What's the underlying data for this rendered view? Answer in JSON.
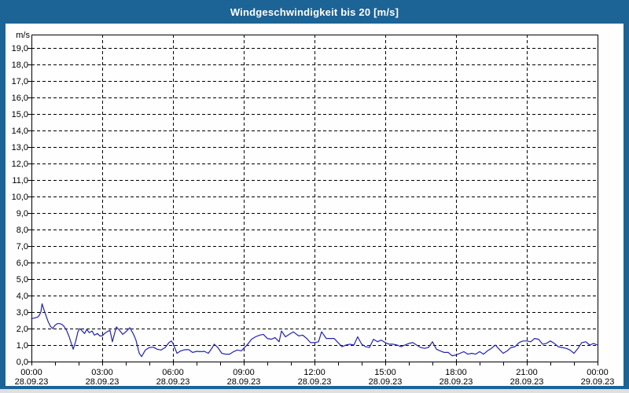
{
  "window": {
    "title": "Windgeschwindigkeit bis 20 [m/s]"
  },
  "colors": {
    "frame_blue": "#1c6396",
    "title_text": "#ffffff",
    "line_blue": "#2323ad",
    "grid_black": "#000000",
    "page_background": "#fdfefd",
    "outer_strip_gray": "#e0e0e0"
  },
  "chart_data": {
    "type": "line",
    "title": "Windgeschwindigkeit bis 20 [m/s]",
    "ylabel": "m/s",
    "xlabel": "",
    "ylim": [
      0,
      20
    ],
    "ytick_step": 1.0,
    "grid": "dashed horizontal every 1.0 m/s, dashed vertical every 3 h",
    "legend": "none",
    "y_axis": {
      "unit_label": "m/s",
      "tick_labels": [
        "0,0",
        "1,0",
        "2,0",
        "3,0",
        "4,0",
        "5,0",
        "6,0",
        "7,0",
        "8,0",
        "9,0",
        "10,0",
        "11,0",
        "12,0",
        "13,0",
        "14,0",
        "15,0",
        "16,0",
        "17,0",
        "18,0",
        "19,0"
      ]
    },
    "x_axis": {
      "range_hours": [
        0,
        24
      ],
      "major_tick_interval_hours": 3,
      "minor_tick_interval_hours": 1,
      "ticks": [
        {
          "hour": 0,
          "time": "00:00",
          "date": "28.09.23"
        },
        {
          "hour": 3,
          "time": "03:00",
          "date": "28.09.23"
        },
        {
          "hour": 6,
          "time": "06:00",
          "date": "28.09.23"
        },
        {
          "hour": 9,
          "time": "09:00",
          "date": "28.09.23"
        },
        {
          "hour": 12,
          "time": "12:00",
          "date": "28.09.23"
        },
        {
          "hour": 15,
          "time": "15:00",
          "date": "28.09.23"
        },
        {
          "hour": 18,
          "time": "18:00",
          "date": "28.09.23"
        },
        {
          "hour": 21,
          "time": "21:00",
          "date": "28.09.23"
        },
        {
          "hour": 24,
          "time": "00:00",
          "date": "29.09.23"
        }
      ]
    },
    "series": [
      {
        "name": "Windgeschwindigkeit",
        "unit": "m/s",
        "color": "#2323ad",
        "points_hours_value": [
          [
            0,
            2.6
          ],
          [
            0.15,
            2.65
          ],
          [
            0.27,
            2.7
          ],
          [
            0.33,
            2.8
          ],
          [
            0.4,
            3.0
          ],
          [
            0.45,
            3.5
          ],
          [
            0.53,
            3.15
          ],
          [
            0.6,
            2.85
          ],
          [
            0.7,
            2.45
          ],
          [
            0.8,
            2.15
          ],
          [
            0.9,
            2.0
          ],
          [
            1.0,
            2.2
          ],
          [
            1.1,
            2.3
          ],
          [
            1.2,
            2.3
          ],
          [
            1.3,
            2.25
          ],
          [
            1.4,
            2.1
          ],
          [
            1.5,
            1.85
          ],
          [
            1.6,
            1.5
          ],
          [
            1.7,
            1.05
          ],
          [
            1.77,
            0.75
          ],
          [
            1.87,
            1.2
          ],
          [
            1.97,
            1.8
          ],
          [
            2.05,
            2.0
          ],
          [
            2.15,
            1.85
          ],
          [
            2.25,
            1.7
          ],
          [
            2.35,
            1.95
          ],
          [
            2.45,
            1.75
          ],
          [
            2.57,
            1.85
          ],
          [
            2.67,
            1.6
          ],
          [
            2.8,
            1.7
          ],
          [
            2.9,
            1.55
          ],
          [
            3.0,
            1.55
          ],
          [
            3.1,
            1.7
          ],
          [
            3.2,
            1.8
          ],
          [
            3.33,
            1.9
          ],
          [
            3.43,
            1.2
          ],
          [
            3.6,
            2.1
          ],
          [
            3.73,
            1.9
          ],
          [
            3.87,
            1.65
          ],
          [
            4.0,
            1.8
          ],
          [
            4.17,
            2.05
          ],
          [
            4.33,
            1.65
          ],
          [
            4.43,
            1.3
          ],
          [
            4.57,
            0.5
          ],
          [
            4.67,
            0.3
          ],
          [
            4.83,
            0.7
          ],
          [
            5.0,
            0.85
          ],
          [
            5.17,
            0.87
          ],
          [
            5.33,
            0.75
          ],
          [
            5.5,
            0.7
          ],
          [
            5.67,
            0.85
          ],
          [
            5.83,
            1.15
          ],
          [
            5.93,
            1.25
          ],
          [
            6.0,
            1.1
          ],
          [
            6.17,
            0.5
          ],
          [
            6.33,
            0.65
          ],
          [
            6.5,
            0.72
          ],
          [
            6.67,
            0.72
          ],
          [
            6.83,
            0.55
          ],
          [
            7.0,
            0.62
          ],
          [
            7.17,
            0.6
          ],
          [
            7.33,
            0.62
          ],
          [
            7.5,
            0.5
          ],
          [
            7.67,
            0.85
          ],
          [
            7.75,
            1.05
          ],
          [
            7.9,
            0.85
          ],
          [
            8.07,
            0.5
          ],
          [
            8.23,
            0.45
          ],
          [
            8.4,
            0.45
          ],
          [
            8.57,
            0.6
          ],
          [
            8.73,
            0.7
          ],
          [
            8.9,
            0.65
          ],
          [
            9.0,
            0.8
          ],
          [
            9.17,
            1.05
          ],
          [
            9.33,
            1.35
          ],
          [
            9.5,
            1.5
          ],
          [
            9.67,
            1.6
          ],
          [
            9.83,
            1.65
          ],
          [
            10.0,
            1.4
          ],
          [
            10.17,
            1.35
          ],
          [
            10.33,
            1.45
          ],
          [
            10.5,
            1.2
          ],
          [
            10.6,
            1.85
          ],
          [
            10.77,
            1.5
          ],
          [
            10.93,
            1.65
          ],
          [
            11.1,
            1.8
          ],
          [
            11.33,
            1.55
          ],
          [
            11.5,
            1.6
          ],
          [
            11.67,
            1.4
          ],
          [
            11.83,
            1.15
          ],
          [
            12.0,
            1.15
          ],
          [
            12.17,
            1.2
          ],
          [
            12.3,
            1.8
          ],
          [
            12.5,
            1.4
          ],
          [
            12.67,
            1.4
          ],
          [
            12.83,
            1.4
          ],
          [
            13.0,
            1.15
          ],
          [
            13.17,
            0.9
          ],
          [
            13.33,
            1.0
          ],
          [
            13.5,
            1.05
          ],
          [
            13.67,
            1.0
          ],
          [
            13.83,
            1.5
          ],
          [
            14.0,
            1.05
          ],
          [
            14.17,
            0.9
          ],
          [
            14.33,
            0.85
          ],
          [
            14.5,
            1.35
          ],
          [
            14.67,
            1.2
          ],
          [
            14.83,
            1.3
          ],
          [
            15.0,
            1.15
          ],
          [
            15.17,
            1.05
          ],
          [
            15.33,
            1.05
          ],
          [
            15.5,
            1.0
          ],
          [
            15.67,
            0.9
          ],
          [
            15.83,
            1.0
          ],
          [
            16.0,
            1.1
          ],
          [
            16.17,
            1.15
          ],
          [
            16.33,
            1.0
          ],
          [
            16.5,
            0.85
          ],
          [
            16.67,
            0.8
          ],
          [
            16.83,
            0.85
          ],
          [
            17.0,
            1.2
          ],
          [
            17.17,
            0.75
          ],
          [
            17.33,
            0.65
          ],
          [
            17.5,
            0.55
          ],
          [
            17.67,
            0.55
          ],
          [
            17.83,
            0.35
          ],
          [
            18.0,
            0.4
          ],
          [
            18.17,
            0.5
          ],
          [
            18.33,
            0.6
          ],
          [
            18.5,
            0.45
          ],
          [
            18.67,
            0.5
          ],
          [
            18.83,
            0.45
          ],
          [
            19.0,
            0.6
          ],
          [
            19.17,
            0.45
          ],
          [
            19.33,
            0.65
          ],
          [
            19.5,
            0.8
          ],
          [
            19.67,
            1.0
          ],
          [
            19.83,
            0.75
          ],
          [
            20.0,
            0.5
          ],
          [
            20.17,
            0.65
          ],
          [
            20.33,
            0.85
          ],
          [
            20.5,
            0.9
          ],
          [
            20.67,
            1.15
          ],
          [
            20.83,
            1.25
          ],
          [
            21.0,
            1.25
          ],
          [
            21.17,
            1.2
          ],
          [
            21.33,
            1.4
          ],
          [
            21.5,
            1.35
          ],
          [
            21.67,
            1.05
          ],
          [
            21.83,
            1.1
          ],
          [
            22.0,
            1.25
          ],
          [
            22.17,
            1.1
          ],
          [
            22.33,
            0.9
          ],
          [
            22.5,
            0.85
          ],
          [
            22.67,
            0.8
          ],
          [
            22.83,
            0.7
          ],
          [
            23.0,
            0.5
          ],
          [
            23.17,
            0.8
          ],
          [
            23.33,
            1.15
          ],
          [
            23.5,
            1.2
          ],
          [
            23.67,
            1.0
          ],
          [
            23.83,
            1.1
          ],
          [
            24.0,
            1.0
          ]
        ]
      }
    ]
  }
}
